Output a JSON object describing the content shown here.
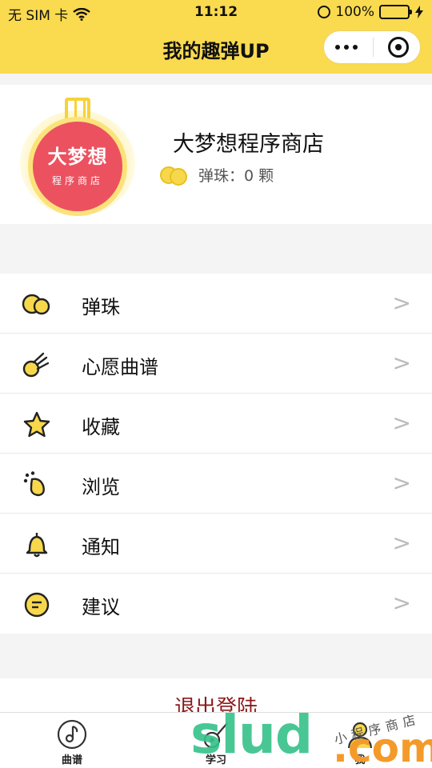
{
  "status_bar": {
    "carrier": "无 SIM 卡",
    "time": "11:12",
    "battery": "100%"
  },
  "nav": {
    "title": "我的趣弹UP"
  },
  "profile": {
    "avatar_line1": "大梦想",
    "avatar_line2": "程序商店",
    "name": "大梦想程序商店",
    "coins_label": "弹珠：0 颗"
  },
  "menu": {
    "items": [
      {
        "label": "弹珠",
        "icon": "marbles-icon"
      },
      {
        "label": "心愿曲谱",
        "icon": "meteor-icon"
      },
      {
        "label": "收藏",
        "icon": "star-icon"
      },
      {
        "label": "浏览",
        "icon": "footprint-icon"
      },
      {
        "label": "通知",
        "icon": "bell-icon"
      },
      {
        "label": "建议",
        "icon": "message-icon"
      }
    ],
    "chevron": ">"
  },
  "logout": {
    "label": "退出登陆"
  },
  "tabbar": {
    "tabs": [
      {
        "label": "曲谱",
        "icon": "music-disc-icon"
      },
      {
        "label": "学习",
        "icon": "guitar-icon"
      },
      {
        "label": "我",
        "icon": "user-icon"
      }
    ]
  },
  "watermark": {
    "brand": "slud",
    "suffix": ".com",
    "caption": "小程序商店"
  },
  "colors": {
    "accent": "#fada4f",
    "logout": "#8b1a1a",
    "avatar": "#ec5160"
  }
}
